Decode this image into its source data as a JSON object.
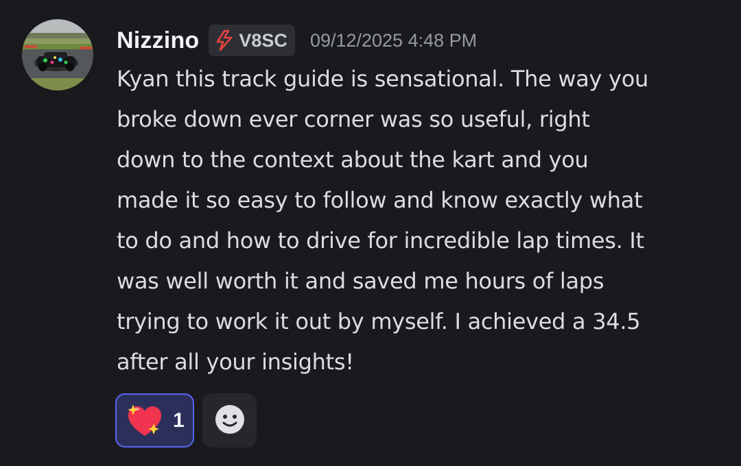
{
  "message": {
    "author": "Nizzino",
    "avatar_icon": "race-car-avatar",
    "tag": {
      "icon": "lightning-bolt-icon",
      "label": "V8SC"
    },
    "timestamp": "09/12/2025 4:48 PM",
    "content_lines": [
      "Kyan this track guide is sensational. The way you",
      "broke down ever corner was so useful, right",
      "down to the context about the kart and you",
      "made it so easy to follow and know exactly what",
      "to do and how to drive for incredible lap times. It",
      "was well worth it and saved me hours of laps",
      "trying to work it out by myself. I achieved a 34.5",
      "after all your insights!"
    ],
    "reactions": [
      {
        "emoji": "sparkling-heart",
        "count": "1",
        "selected": true
      }
    ],
    "add_reaction_icon": "smiley-face-icon"
  },
  "colors": {
    "background": "#1a1a1e",
    "username": "#f2f3f5",
    "text": "#dbdee1",
    "timestamp": "#949ba4",
    "reaction_border": "#5865f2",
    "reaction_bg": "#2c2f5a"
  }
}
